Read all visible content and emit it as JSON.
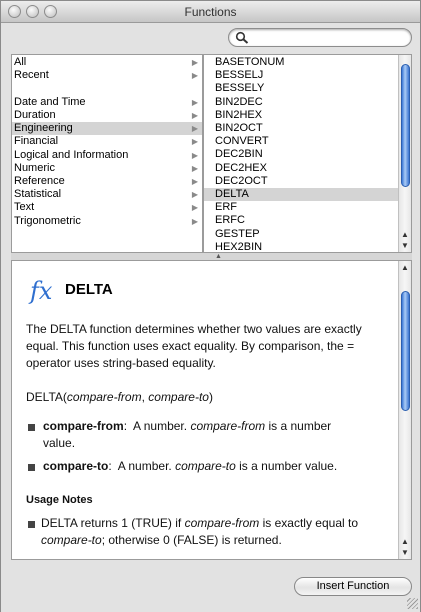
{
  "window": {
    "title": "Functions"
  },
  "search": {
    "value": "",
    "placeholder": ""
  },
  "categories": [
    {
      "label": "All",
      "selected": false
    },
    {
      "label": "Recent",
      "selected": false
    },
    {
      "label": "Date and Time",
      "selected": false
    },
    {
      "label": "Duration",
      "selected": false
    },
    {
      "label": "Engineering",
      "selected": true
    },
    {
      "label": "Financial",
      "selected": false
    },
    {
      "label": "Logical and Information",
      "selected": false
    },
    {
      "label": "Numeric",
      "selected": false
    },
    {
      "label": "Reference",
      "selected": false
    },
    {
      "label": "Statistical",
      "selected": false
    },
    {
      "label": "Text",
      "selected": false
    },
    {
      "label": "Trigonometric",
      "selected": false
    }
  ],
  "functions": [
    {
      "label": "BASETONUM",
      "selected": false
    },
    {
      "label": "BESSELJ",
      "selected": false
    },
    {
      "label": "BESSELY",
      "selected": false
    },
    {
      "label": "BIN2DEC",
      "selected": false
    },
    {
      "label": "BIN2HEX",
      "selected": false
    },
    {
      "label": "BIN2OCT",
      "selected": false
    },
    {
      "label": "CONVERT",
      "selected": false
    },
    {
      "label": "DEC2BIN",
      "selected": false
    },
    {
      "label": "DEC2HEX",
      "selected": false
    },
    {
      "label": "DEC2OCT",
      "selected": false
    },
    {
      "label": "DELTA",
      "selected": true
    },
    {
      "label": "ERF",
      "selected": false
    },
    {
      "label": "ERFC",
      "selected": false
    },
    {
      "label": "GESTEP",
      "selected": false
    },
    {
      "label": "HEX2BIN",
      "selected": false
    }
  ],
  "doc": {
    "fx_glyph": "fx",
    "title": "DELTA",
    "description": [
      "The DELTA function determines whether two values are exactly",
      "equal. This function uses exact equality. By comparison, the =",
      "operator uses string-based equality."
    ],
    "syntax_name": "DELTA",
    "syntax_open": "(",
    "syntax_arg1": "compare-from",
    "syntax_sep": ", ",
    "syntax_arg2": "compare-to",
    "syntax_close": ")",
    "arg1_name": "compare-from",
    "arg1_colon": ":",
    "arg1_text": "A number.",
    "arg1_ref": "compare-from",
    "arg1_rest": "is a number",
    "arg1_line2": "value.",
    "arg2_name": "compare-to",
    "arg2_colon": ":",
    "arg2_text": "A number.",
    "arg2_ref": "compare-to",
    "arg2_rest": "is a number value.",
    "usage_heading": "Usage Notes",
    "usage_l1a": "DELTA returns 1 (TRUE) if",
    "usage_l1b": "compare-from",
    "usage_l1c": "is exactly equal to",
    "usage_l2a": "compare-to",
    "usage_l2b": "; otherwise 0 (FALSE) is returned."
  },
  "buttons": {
    "insert": "Insert Function"
  },
  "colors": {
    "selection": "#d4d4d4",
    "scroll_thumb": "#3c78d6",
    "fx_glyph": "#2f6fcf"
  }
}
